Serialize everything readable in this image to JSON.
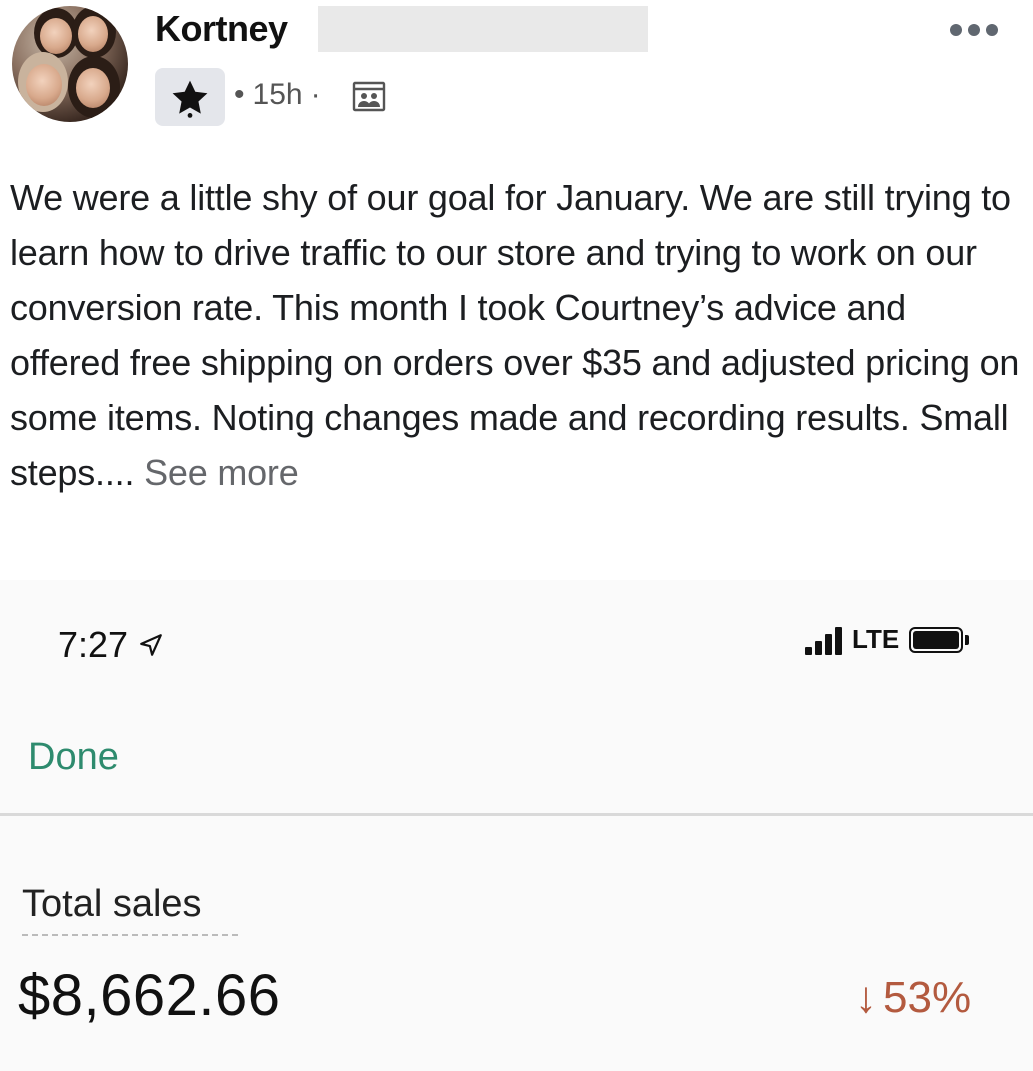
{
  "post": {
    "author_name": "Kortney",
    "timestamp": "15h",
    "separator": "•",
    "separator2": "·",
    "body_text": "We were a little shy of our goal for January. We are still trying to learn how to drive traffic to our store and trying to work on our conversion rate. This month I took Courtney’s advice and offered free shipping on orders over $35 and adjusted pricing on some items. Noting changes made and recording results. Small steps.... ",
    "see_more_label": "See more",
    "icons": {
      "more": "more-options-icon",
      "badge": "star-badge-icon",
      "privacy": "group-privacy-icon"
    }
  },
  "screenshot": {
    "status_time": "7:27",
    "network_label": "LTE",
    "done_label": "Done",
    "total_sales_label": "Total sales",
    "total_sales_value": "$8,662.66",
    "change_arrow": "↓",
    "change_percent": "53%",
    "colors": {
      "done": "#2e8b6e",
      "change_negative": "#b35a3f"
    }
  }
}
